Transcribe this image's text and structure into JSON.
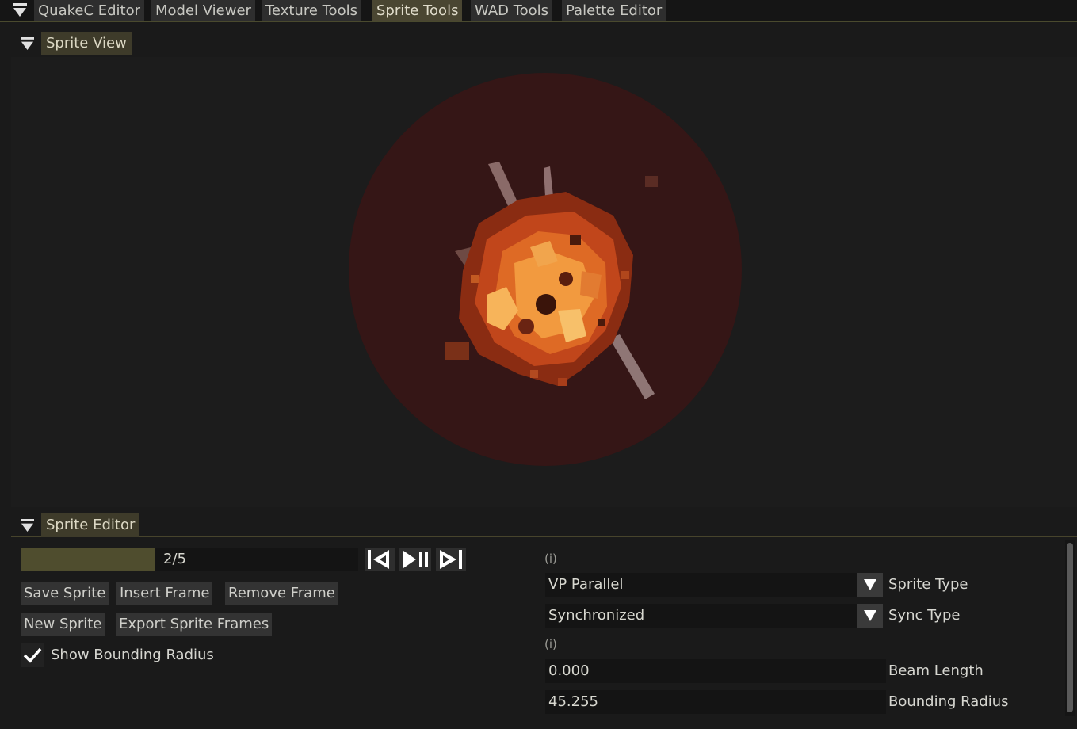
{
  "tabs": [
    {
      "label": "QuakeC Editor",
      "active": false
    },
    {
      "label": "Model Viewer",
      "active": false
    },
    {
      "label": "Texture Tools",
      "active": false
    },
    {
      "label": "Sprite Tools",
      "active": true
    },
    {
      "label": "WAD Tools",
      "active": false
    },
    {
      "label": "Palette Editor",
      "active": false
    }
  ],
  "sprite_view": {
    "title": "Sprite View",
    "bounding_circle_color": "#3a1414",
    "sprite": "explosion-sprite"
  },
  "sprite_editor": {
    "title": "Sprite Editor",
    "frame_slider": {
      "text": "2/5",
      "current": 2,
      "total": 5
    },
    "controls": {
      "first_frame_icon": "first-frame-icon",
      "play_pause_icon": "play-pause-icon",
      "last_frame_icon": "last-frame-icon"
    },
    "buttons": {
      "save_sprite": "Save Sprite",
      "insert_frame": "Insert Frame",
      "remove_frame": "Remove Frame",
      "new_sprite": "New Sprite",
      "export_sprite_frames": "Export Sprite Frames"
    },
    "show_bounding_radius": {
      "label": "Show Bounding Radius",
      "checked": true
    },
    "properties": {
      "info_marker_1": "(i)",
      "sprite_type": {
        "value": "VP Parallel",
        "label": "Sprite Type"
      },
      "sync_type": {
        "value": "Synchronized",
        "label": "Sync Type"
      },
      "info_marker_2": "(i)",
      "beam_length": {
        "value": "0.000",
        "label": "Beam Length"
      },
      "bounding_radius": {
        "value": "45.255",
        "label": "Bounding Radius"
      }
    }
  },
  "colors": {
    "accent": "#4a4632",
    "slider_fill": "#4f4d2e",
    "background": "#1a1a1a"
  }
}
